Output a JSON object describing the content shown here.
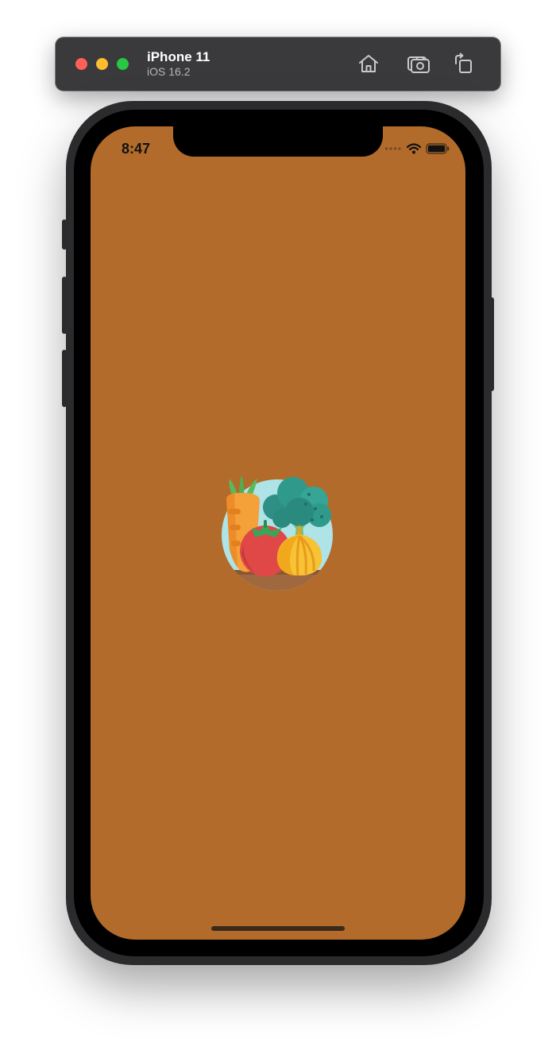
{
  "simulator": {
    "device_name": "iPhone 11",
    "os_version": "iOS 16.2",
    "toolbar_icons": [
      "home-icon",
      "screenshot-icon",
      "rotate-icon"
    ],
    "traffic_light_colors": {
      "close": "#ff5f57",
      "minimize": "#febc2e",
      "zoom": "#28c840"
    }
  },
  "status_bar": {
    "time": "8:47",
    "icons": [
      "signal-dots-icon",
      "wifi-icon",
      "battery-icon"
    ]
  },
  "screen": {
    "background_color": "#b26b2a",
    "splash_logo": "vegetables-logo-icon"
  }
}
